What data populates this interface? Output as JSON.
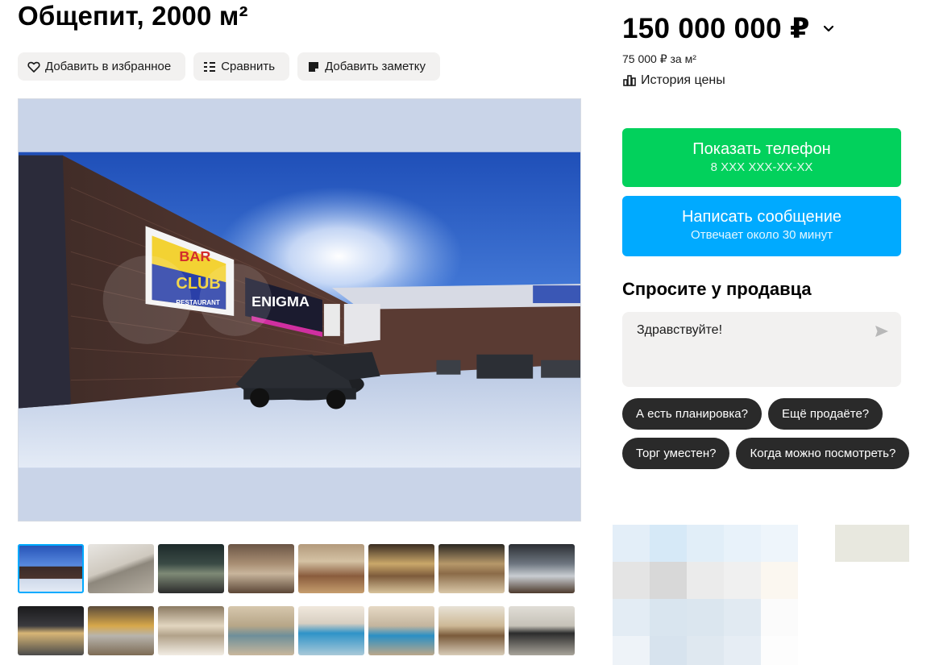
{
  "listing": {
    "title": "Общепит, 2000 м²"
  },
  "actions": {
    "favorite_label": "Добавить в избранное",
    "compare_label": "Сравнить",
    "note_label": "Добавить заметку"
  },
  "photo": {
    "sign_bar": "BAR",
    "sign_club": "CLUB",
    "sign_restaurant": "RESTAURANT",
    "sign_enigma": "ENIGMA"
  },
  "thumbnails": {
    "count": 16,
    "active_index": 0
  },
  "price": {
    "amount": "150 000 000 ₽",
    "per_m2": "75 000 ₽ за м²",
    "history_label": "История цены"
  },
  "contact": {
    "phone_label": "Показать телефон",
    "phone_masked": "8 XXX XXX-XX-XX",
    "message_label": "Написать сообщение",
    "message_sub": "Отвечает около 30 минут"
  },
  "ask": {
    "title": "Спросите у продавца",
    "message_value": "Здравствуйте!",
    "chips": [
      "А есть планировка?",
      "Ещё продаёте?",
      "Торг уместен?",
      "Когда можно посмотреть?"
    ]
  },
  "colors": {
    "green": "#02d15c",
    "blue": "#00aaff",
    "chip_bg": "#2a2a2a",
    "light_bg": "#f2f1f0"
  }
}
